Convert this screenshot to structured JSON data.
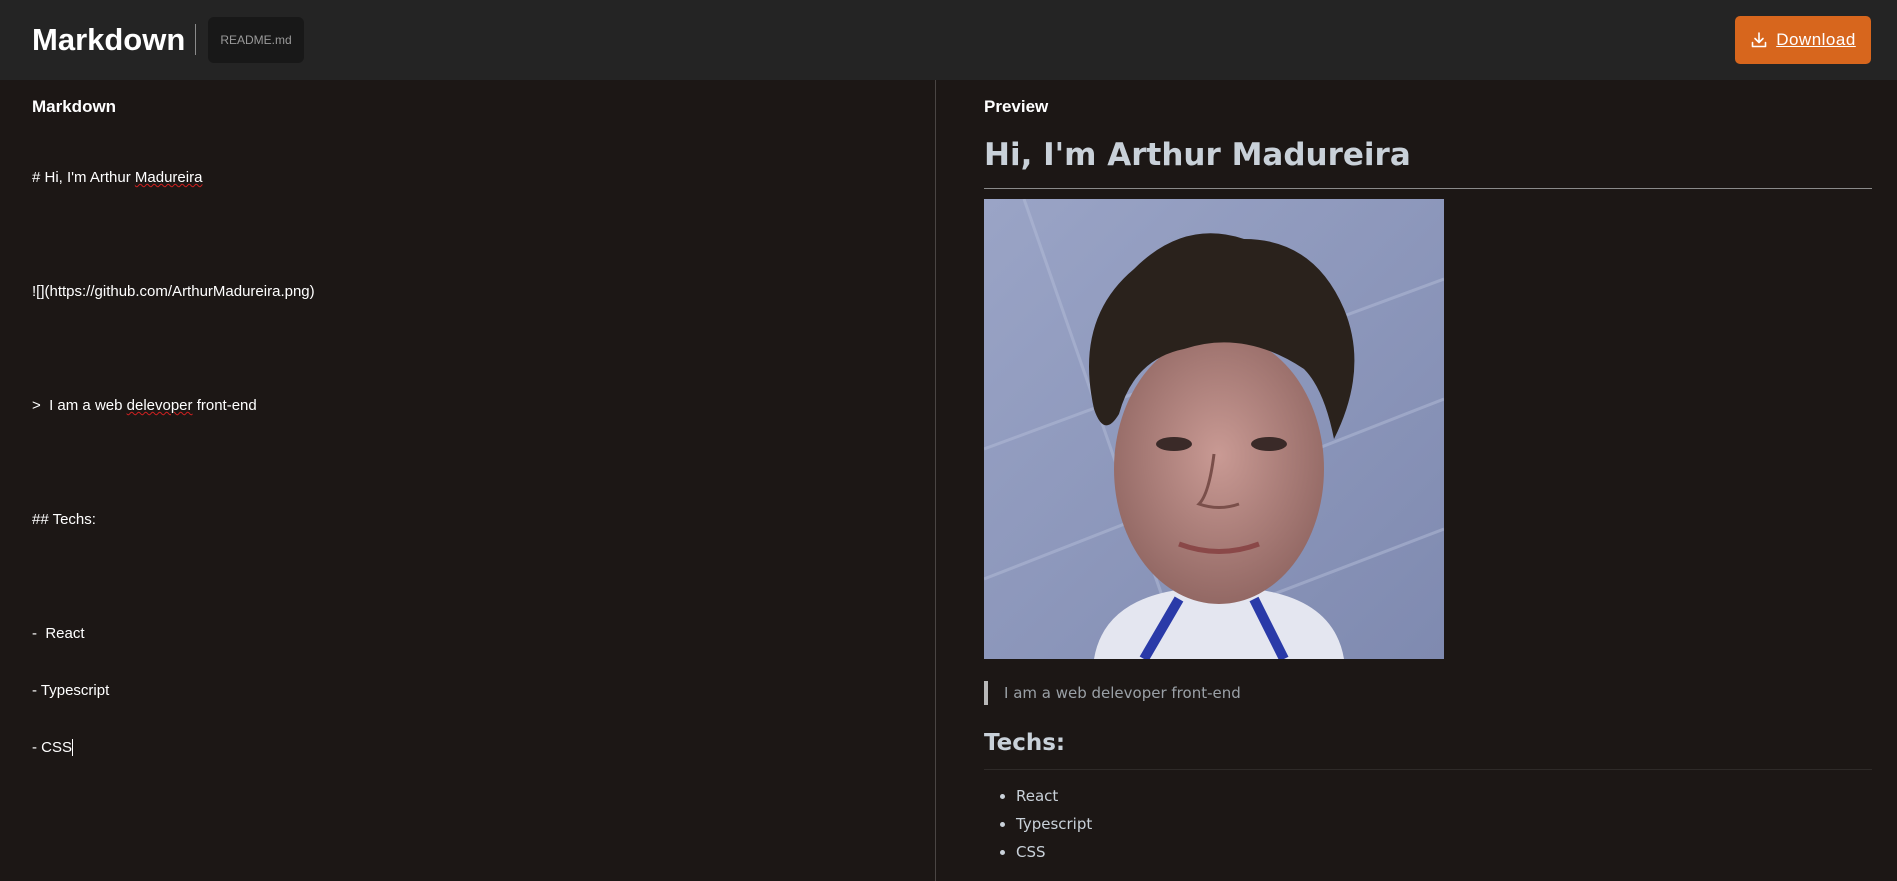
{
  "header": {
    "title": "Markdown",
    "file_name": "README.md",
    "download_label": "Download"
  },
  "editor": {
    "heading": "Markdown",
    "lines": {
      "l1_pre": "# Hi, I'm Arthur ",
      "l1_spell": "Madureira",
      "l2": "![](https://github.com/ArthurMadureira.png)",
      "l3_pre": ">  I am a web ",
      "l3_spell": "delevoper",
      "l3_post": " front-end",
      "l4": "## Techs:",
      "l5": "-  React",
      "l6": "- Typescript",
      "l7": "- CSS"
    }
  },
  "preview": {
    "heading": "Preview",
    "h1": "Hi, I'm Arthur Madureira",
    "blockquote": "I am a web delevoper front-end",
    "h2": "Techs:",
    "techs": [
      "React",
      "Typescript",
      "CSS"
    ]
  },
  "colors": {
    "background": "#1c1715",
    "topbar": "#242424",
    "accent": "#d7661d"
  }
}
